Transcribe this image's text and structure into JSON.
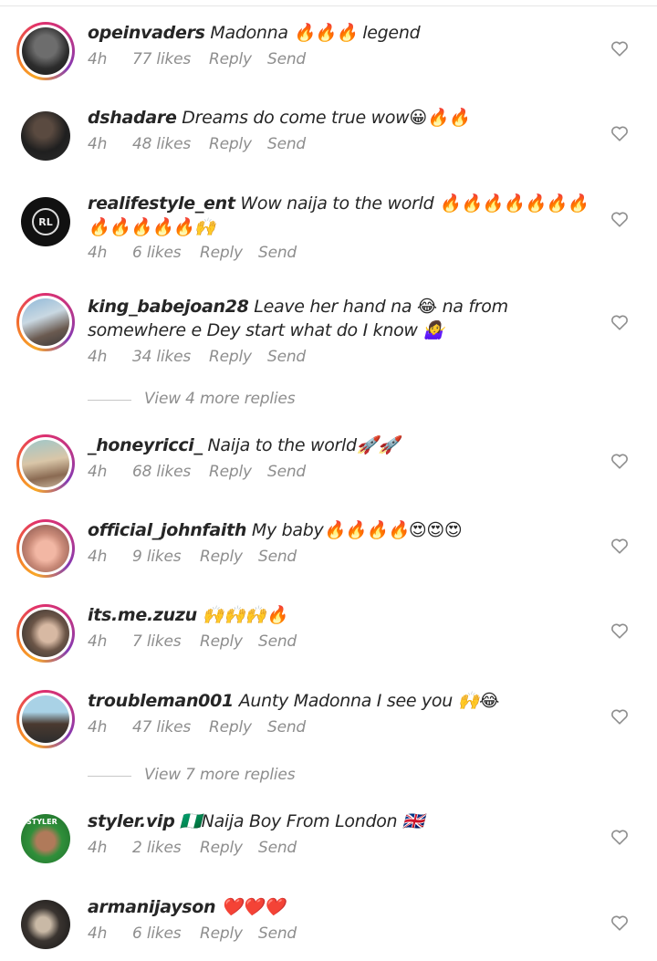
{
  "comments": [
    {
      "username": "opeinvaders",
      "text": "Madonna 🔥🔥🔥 legend",
      "time": "4h",
      "likes": "77 likes",
      "reply": "Reply",
      "send": "Send"
    },
    {
      "username": "dshadare",
      "text": "Dreams do come true wow😀🔥🔥",
      "time": "4h",
      "likes": "48 likes",
      "reply": "Reply",
      "send": "Send"
    },
    {
      "username": "realifestyle_ent",
      "text": "Wow naija to the world 🔥🔥🔥🔥🔥🔥🔥🔥🔥🔥🔥🔥🙌",
      "time": "4h",
      "likes": "6 likes",
      "reply": "Reply",
      "send": "Send"
    },
    {
      "username": "king_babejoan28",
      "text": "Leave her hand na 😂 na from somewhere e Dey start what do I know 🤷‍♀️",
      "time": "4h",
      "likes": "34 likes",
      "reply": "Reply",
      "send": "Send"
    },
    {
      "username": "_honeyricci_",
      "text": "Naija to the world🚀🚀",
      "time": "4h",
      "likes": "68 likes",
      "reply": "Reply",
      "send": "Send"
    },
    {
      "username": "official_johnfaith",
      "text": "My baby🔥🔥🔥🔥😍😍😍",
      "time": "4h",
      "likes": "9 likes",
      "reply": "Reply",
      "send": "Send"
    },
    {
      "username": "its.me.zuzu",
      "text": "🙌🙌🙌🔥",
      "time": "4h",
      "likes": "7 likes",
      "reply": "Reply",
      "send": "Send"
    },
    {
      "username": "troubleman001",
      "text": "Aunty Madonna I see you 🙌😂",
      "time": "4h",
      "likes": "47 likes",
      "reply": "Reply",
      "send": "Send"
    },
    {
      "username": "styler.vip",
      "text": "🇳🇬Naija Boy From London 🇬🇧",
      "time": "4h",
      "likes": "2 likes",
      "reply": "Reply",
      "send": "Send"
    },
    {
      "username": "armanijayson",
      "text": "❤️❤️❤️",
      "time": "4h",
      "likes": "6 likes",
      "reply": "Reply",
      "send": "Send"
    }
  ],
  "view_more_1": "View 4 more replies",
  "view_more_2": "View 7 more replies",
  "avatar_3_initials": "RL",
  "avatar_9_text": "STYLER",
  "colors": {
    "meta": "#8e8e8e",
    "text": "#262626",
    "ring_start": "#f9a826",
    "ring_end": "#833ab4"
  }
}
